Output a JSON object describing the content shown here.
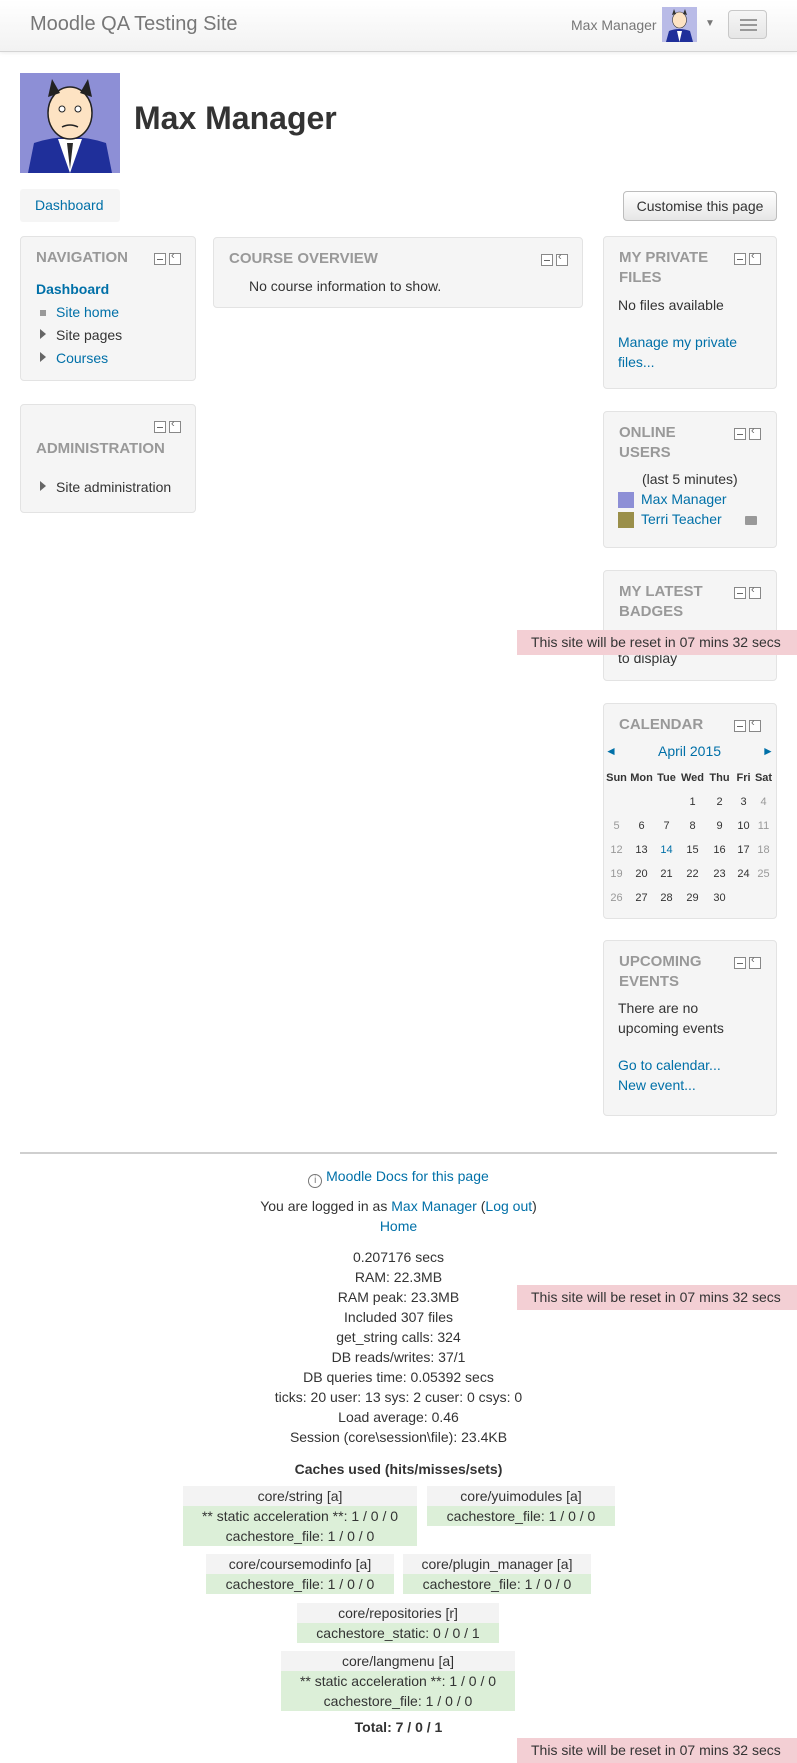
{
  "header": {
    "site_name": "Moodle QA Testing Site",
    "user_name": "Max Manager"
  },
  "page": {
    "title": "Max Manager",
    "breadcrumb": "Dashboard",
    "customise_label": "Customise this page"
  },
  "navigation": {
    "title": "NAVIGATION",
    "dashboard": "Dashboard",
    "items": [
      "Site home",
      "Site pages",
      "Courses"
    ]
  },
  "administration": {
    "title": "ADMINISTRATION",
    "item": "Site administration"
  },
  "course_overview": {
    "title": "COURSE OVERVIEW",
    "message": "No course information to show."
  },
  "private_files": {
    "title_1": "MY PRIVATE",
    "title_2": "FILES",
    "message": "No files available",
    "link_1": "Manage my private",
    "link_2": "files..."
  },
  "online_users": {
    "title_1": "ONLINE",
    "title_2": "USERS",
    "period": "(last 5 minutes)",
    "users": [
      "Max Manager",
      "Terri Teacher"
    ]
  },
  "badges": {
    "title_1": "MY LATEST",
    "title_2": "BADGES",
    "message_tail": "to display"
  },
  "calendar": {
    "title": "CALENDAR",
    "month": "April 2015",
    "prev": "◄",
    "next": "►",
    "weekdays": [
      "Sun",
      "Mon",
      "Tue",
      "Wed",
      "Thu",
      "Fri",
      "Sat"
    ],
    "weeks": [
      [
        "",
        "",
        "",
        "1",
        "2",
        "3",
        "4"
      ],
      [
        "5",
        "6",
        "7",
        "8",
        "9",
        "10",
        "11"
      ],
      [
        "12",
        "13",
        "14",
        "15",
        "16",
        "17",
        "18"
      ],
      [
        "19",
        "20",
        "21",
        "22",
        "23",
        "24",
        "25"
      ],
      [
        "26",
        "27",
        "28",
        "29",
        "30",
        "",
        ""
      ]
    ],
    "today": "14"
  },
  "upcoming": {
    "title_1": "UPCOMING",
    "title_2": "EVENTS",
    "message_1": "There are no",
    "message_2": "upcoming events",
    "link_calendar": "Go to calendar...",
    "link_new": "New event..."
  },
  "reset_notice": "This site will be reset in 07 mins 32 secs",
  "footer": {
    "docs_link": "Moodle Docs for this page",
    "logged_prefix": "You are logged in as",
    "logged_user": "Max Manager",
    "logout": "Log out",
    "home": "Home",
    "perf": [
      "0.207176 secs",
      "RAM: 22.3MB",
      "RAM peak: 23.3MB",
      "Included 307 files",
      "get_string calls: 324",
      "DB reads/writes: 37/1",
      "DB queries time: 0.05392 secs",
      "ticks: 20 user: 13 sys: 2 cuser: 0 csys: 0",
      "Load average: 0.46",
      "Session (core\\session\\file): 23.4KB"
    ],
    "caches_title": "Caches used (hits/misses/sets)",
    "caches": [
      {
        "name": "core/string [a]",
        "rows": [
          "** static acceleration **: 1 / 0 / 0",
          "cachestore_file: 1 / 0 / 0"
        ]
      },
      {
        "name": "core/yuimodules [a]",
        "rows": [
          "cachestore_file: 1 / 0 / 0"
        ]
      },
      {
        "name": "core/coursemodinfo [a]",
        "rows": [
          "cachestore_file: 1 / 0 / 0"
        ]
      },
      {
        "name": "core/plugin_manager [a]",
        "rows": [
          "cachestore_file: 1 / 0 / 0"
        ]
      },
      {
        "name": "core/repositories [r]",
        "rows": [
          "cachestore_static: 0 / 0 / 1"
        ]
      },
      {
        "name": "core/langmenu [a]",
        "rows": [
          "** static acceleration **: 1 / 0 / 0",
          "cachestore_file: 1 / 0 / 0"
        ]
      }
    ],
    "total": "Total: 7 / 0 / 1"
  }
}
